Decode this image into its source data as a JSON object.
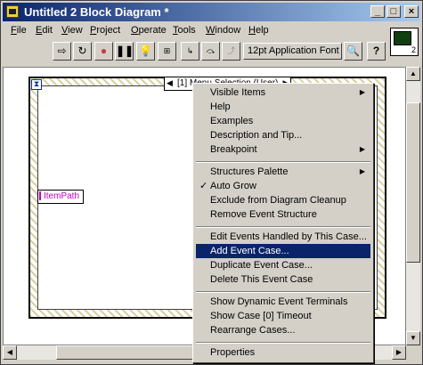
{
  "window": {
    "title": "Untitled 2 Block Diagram *"
  },
  "menubar": [
    {
      "label": "File",
      "underline": "F",
      "rest": "ile"
    },
    {
      "label": "Edit",
      "underline": "E",
      "rest": "dit"
    },
    {
      "label": "View",
      "underline": "V",
      "rest": "iew"
    },
    {
      "label": "Project",
      "underline": "P",
      "rest": "roject"
    },
    {
      "label": "Operate",
      "underline": "O",
      "rest": "perate"
    },
    {
      "label": "Tools",
      "underline": "T",
      "rest": "ools"
    },
    {
      "label": "Window",
      "underline": "W",
      "rest": "indow"
    },
    {
      "label": "Help",
      "underline": "H",
      "rest": "elp"
    }
  ],
  "toolbar": {
    "font_select": "12pt Application Font"
  },
  "vi_icon": {
    "number": "2"
  },
  "diagram": {
    "case_selector": "[1] Menu Selection (User)",
    "node_label": "ItemPath"
  },
  "context_menu": {
    "items": [
      "Visible Items",
      "Help",
      "Examples",
      "Description and Tip...",
      "Breakpoint",
      "Structures Palette",
      "Auto Grow",
      "Exclude from Diagram Cleanup",
      "Remove Event Structure",
      "Edit Events Handled by This Case...",
      "Add Event Case...",
      "Duplicate Event Case...",
      "Delete This Event Case",
      "Show Dynamic Event Terminals",
      "Show Case [0] Timeout",
      "Rearrange Cases...",
      "Properties"
    ],
    "highlighted": "Add Event Case...",
    "checked": "Auto Grow"
  },
  "icons": [
    "run-arrow-icon",
    "run-continuous-icon",
    "abort-icon",
    "pause-icon",
    "highlight-execution-icon",
    "retain-wire-values-icon",
    "step-into-icon",
    "step-over-icon",
    "step-out-icon",
    "search-icon",
    "help-icon"
  ]
}
